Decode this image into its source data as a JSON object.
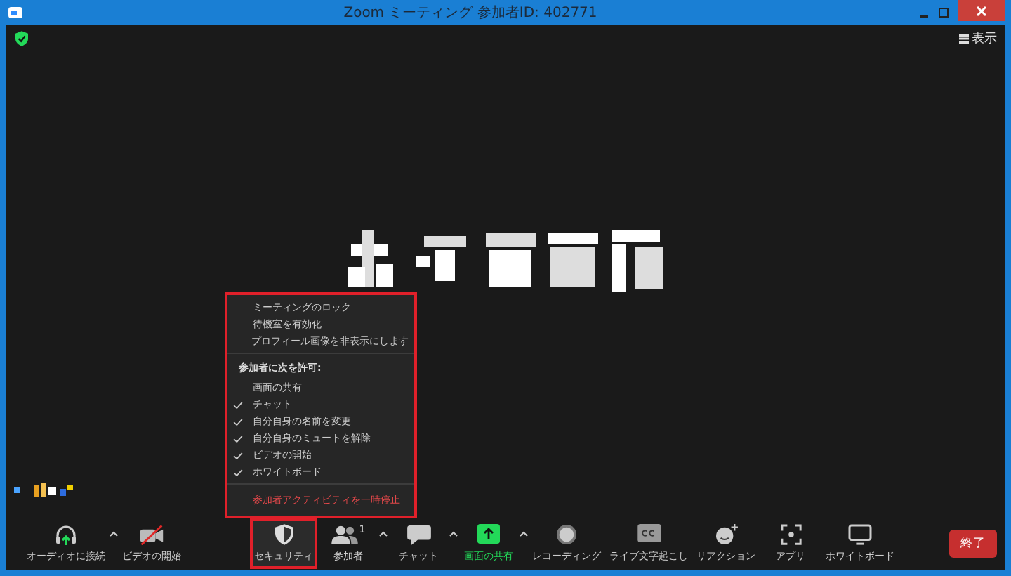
{
  "window": {
    "title": "Zoom ミーティング 参加者ID: 402771"
  },
  "view_button": {
    "label": "表示"
  },
  "security_menu": {
    "highlighted": true,
    "groups": [
      {
        "items": [
          {
            "label": "ミーティングのロック",
            "checked": false
          },
          {
            "label": "待機室を有効化",
            "checked": false
          },
          {
            "label": "プロフィール画像を非表示にします",
            "checked": false
          }
        ]
      },
      {
        "heading": "参加者に次を許可:",
        "items": [
          {
            "label": "画面の共有",
            "checked": false
          },
          {
            "label": "チャット",
            "checked": true
          },
          {
            "label": "自分自身の名前を変更",
            "checked": true
          },
          {
            "label": "自分自身のミュートを解除",
            "checked": true
          },
          {
            "label": "ビデオの開始",
            "checked": true
          },
          {
            "label": "ホワイトボード",
            "checked": true
          }
        ]
      },
      {
        "danger": "参加者アクティビティを一時停止"
      }
    ]
  },
  "toolbar": [
    {
      "kind": "audio",
      "label": "オーディオに接続",
      "caret": true
    },
    {
      "kind": "video",
      "label": "ビデオの開始",
      "off": true,
      "caret": false
    },
    {
      "kind": "security",
      "label": "セキュリティ",
      "highlighted": true,
      "caret": false
    },
    {
      "kind": "participants",
      "label": "参加者",
      "count": "1",
      "caret": true
    },
    {
      "kind": "chat",
      "label": "チャット",
      "caret": true
    },
    {
      "kind": "share",
      "label": "画面の共有",
      "active": true,
      "caret": true
    },
    {
      "kind": "record",
      "label": "レコーディング",
      "caret": false
    },
    {
      "kind": "captions",
      "label": "ライブ文字起こし",
      "caret": false
    },
    {
      "kind": "reactions",
      "label": "リアクション",
      "caret": false
    },
    {
      "kind": "apps",
      "label": "アプリ",
      "caret": false
    },
    {
      "kind": "whiteboard",
      "label": "ホワイトボード",
      "caret": false
    }
  ],
  "end_button": {
    "label": "終了"
  }
}
